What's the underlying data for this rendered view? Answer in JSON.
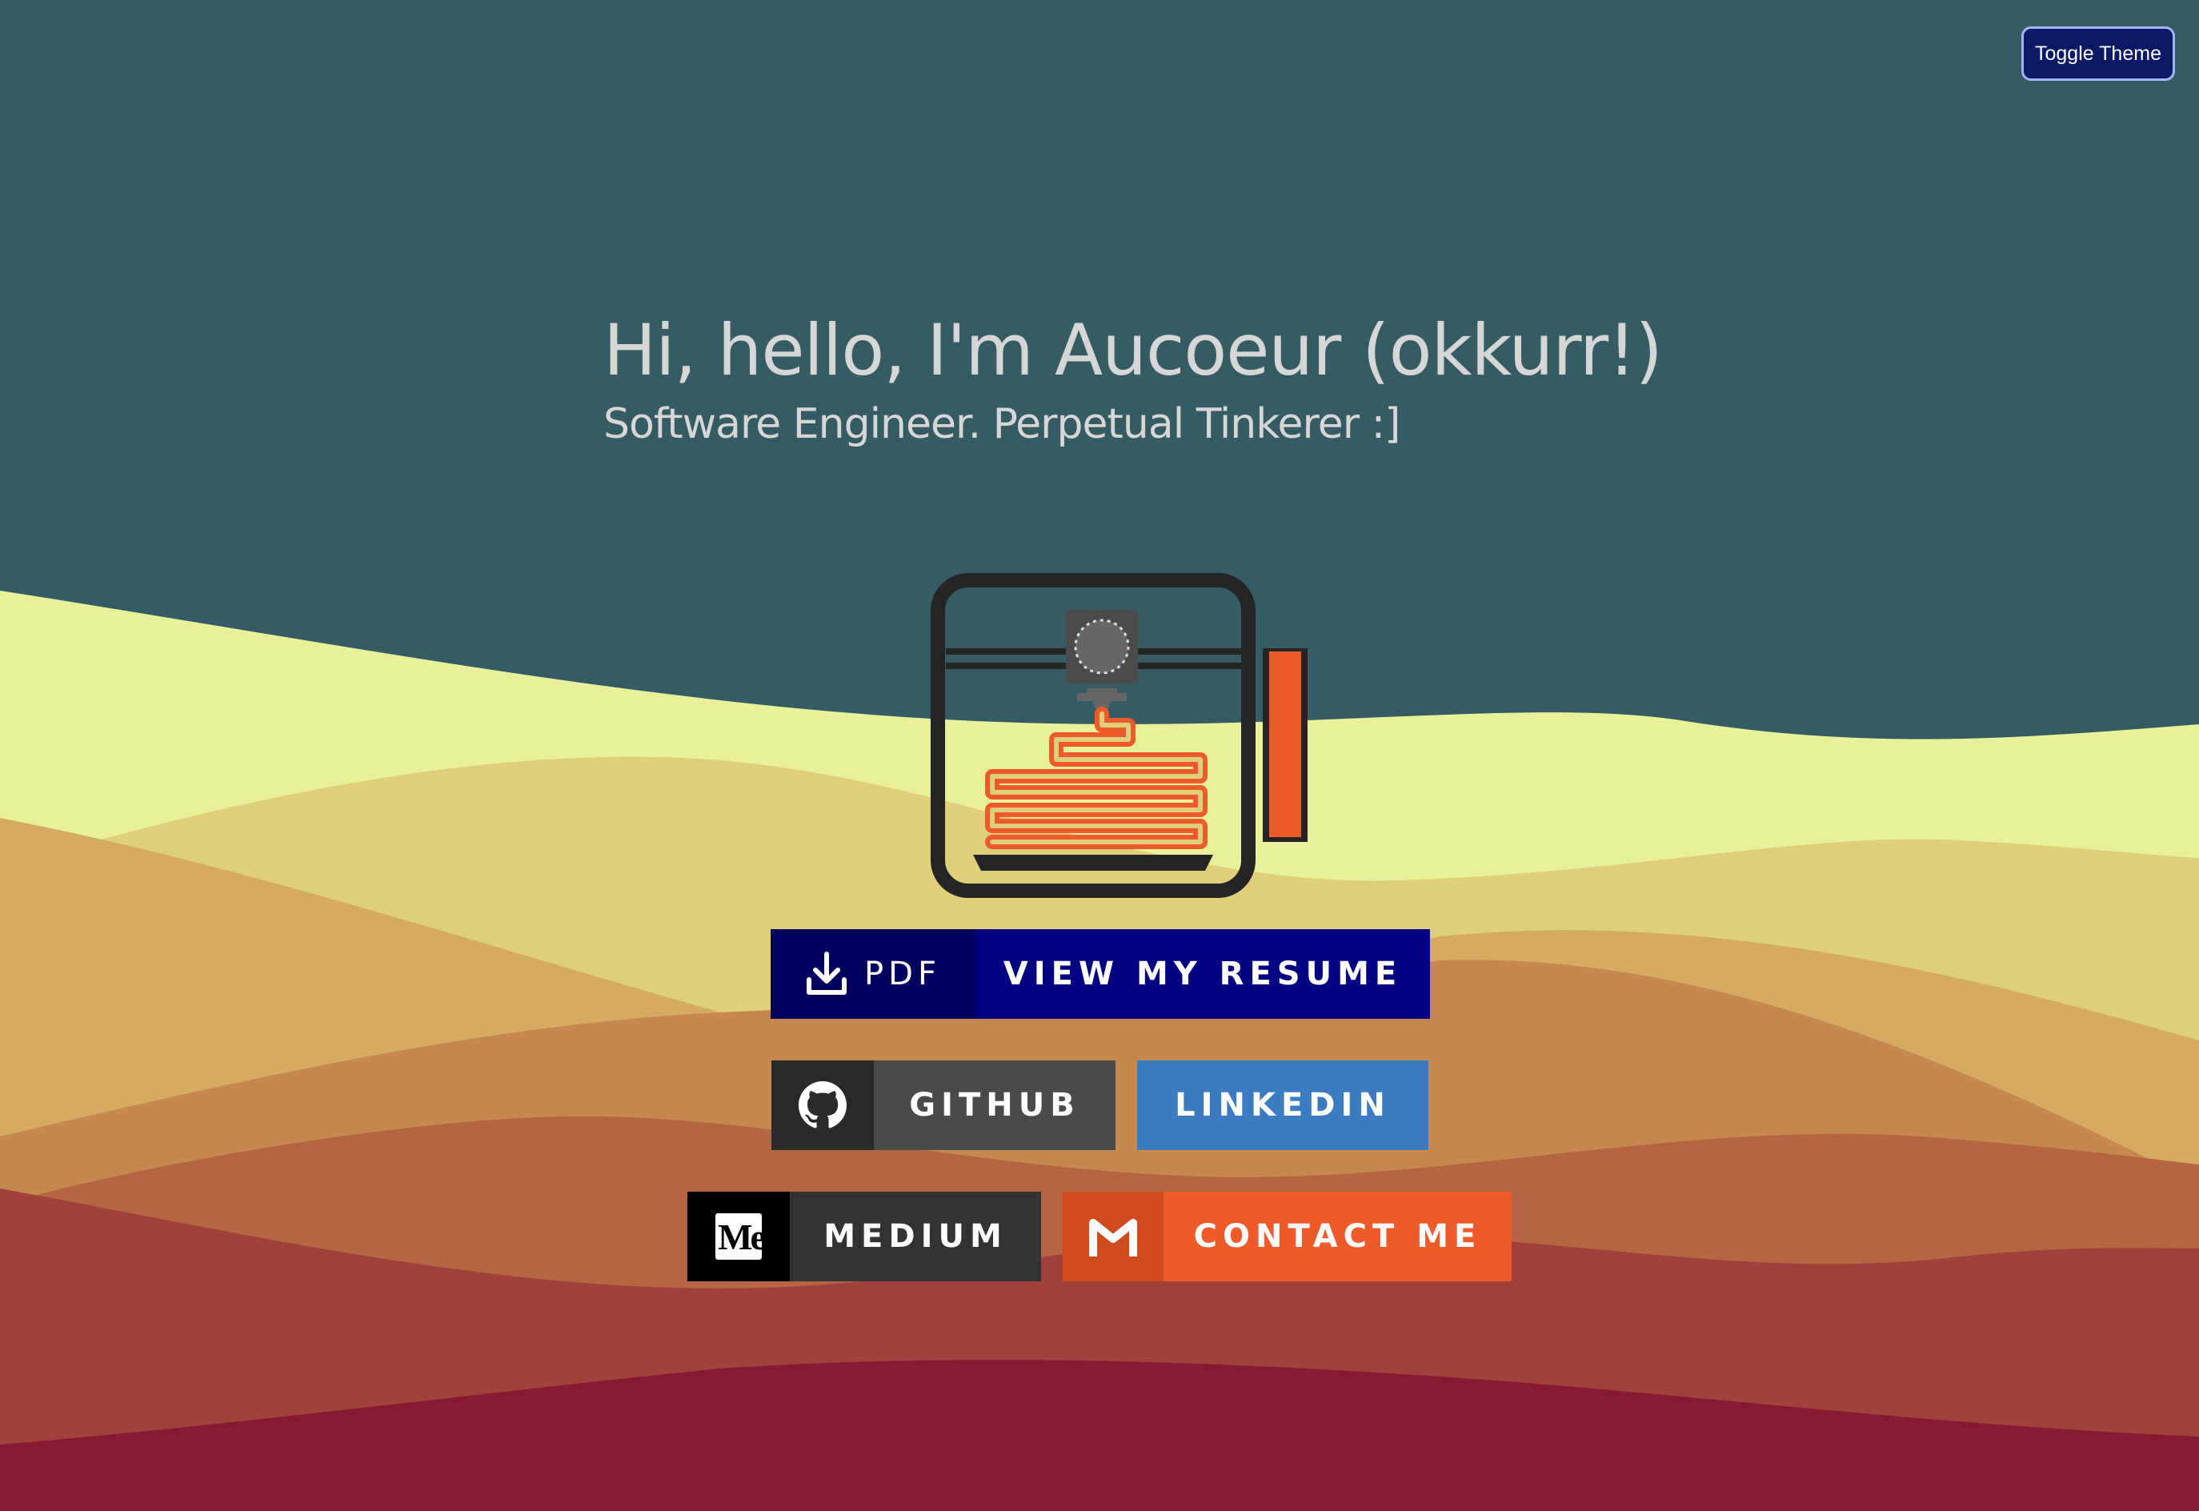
{
  "header": {
    "toggle_label": "Toggle Theme"
  },
  "hero": {
    "title": "Hi, hello, I'm Aucoeur (okkurr!)",
    "subtitle": "Software Engineer. Perpetual Tinkerer :]"
  },
  "illustration": {
    "icon": "3d-printer-icon",
    "accent_color": "#ee5a2a"
  },
  "buttons": {
    "resume": {
      "prefix": "PDF",
      "label": "VIEW MY RESUME",
      "icon": "download-icon",
      "color": "#010082"
    },
    "github": {
      "label": "GITHUB",
      "icon": "github-icon",
      "color": "#4a4a4a"
    },
    "linkedin": {
      "label": "LINKEDIN",
      "color": "#3b7bc0"
    },
    "medium": {
      "label": "MEDIUM",
      "icon": "medium-icon",
      "icon_text": "Me",
      "color": "#333333"
    },
    "contact": {
      "label": "CONTACT ME",
      "icon": "gmail-icon",
      "color": "#ee5a2a"
    }
  },
  "theme": {
    "sky": "#365c63",
    "waves": [
      "#e9f09a",
      "#dfcf7b",
      "#d4ab61",
      "#c6884e",
      "#b46642",
      "#a0413b",
      "#861a33"
    ]
  }
}
